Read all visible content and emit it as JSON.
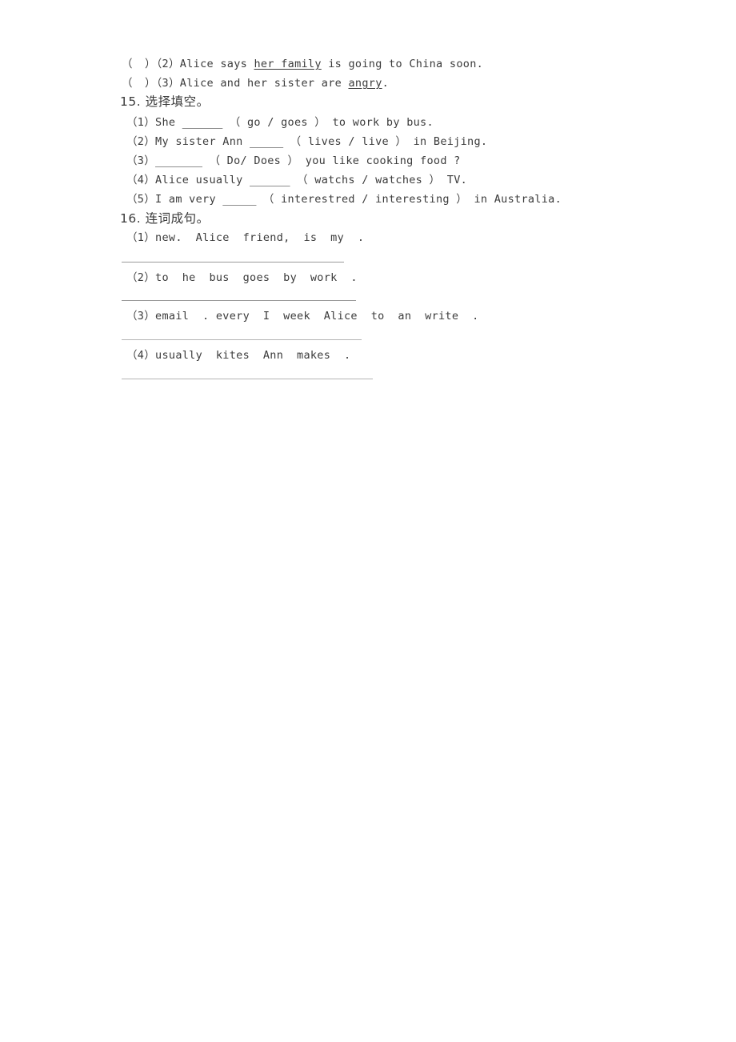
{
  "document": {
    "type": "worksheet-scan",
    "text_color": "#3b3b3b",
    "rule_color": "#9a9a9a",
    "background": "#ffffff"
  },
  "judging_items": {
    "bracket": "（　）",
    "items": [
      {
        "number": "（2）",
        "text_before": "Alice says ",
        "underlined": "her family",
        "text_after": " is going to China soon."
      },
      {
        "number": "（3）",
        "text_before": "Alice and her sister are ",
        "underlined": "angry",
        "text_after": "."
      }
    ]
  },
  "section_15": {
    "heading": "15. 选择填空。",
    "items": [
      {
        "number": "（1）",
        "before": "She ",
        "blank": "______",
        "after": " （ go / goes ） to work by bus."
      },
      {
        "number": "（2）",
        "before": "My sister Ann ",
        "blank": "_____",
        "after": " （ lives / live ） in Beijing."
      },
      {
        "number": "（3）",
        "before": "",
        "blank": "_______",
        "after": " （ Do/ Does ） you like cooking food ?"
      },
      {
        "number": "（4）",
        "before": "Alice usually ",
        "blank": "______",
        "after": " （ watchs / watches ） TV."
      },
      {
        "number": "（5）",
        "before": "I am very ",
        "blank": "_____",
        "after": " （ interestred / interesting ） in Australia."
      }
    ]
  },
  "section_16": {
    "heading": "16. 连词成句。",
    "items": [
      {
        "number": "（1）",
        "words": "new.  Alice  friend,  is  my  ."
      },
      {
        "number": "（2）",
        "words": "to  he  bus  goes  by  work  ."
      },
      {
        "number": "（3）",
        "words": "email  . every  I  week  Alice  to  an  write  ."
      },
      {
        "number": "（4）",
        "words": "usually  kites  Ann  makes  ."
      }
    ]
  }
}
